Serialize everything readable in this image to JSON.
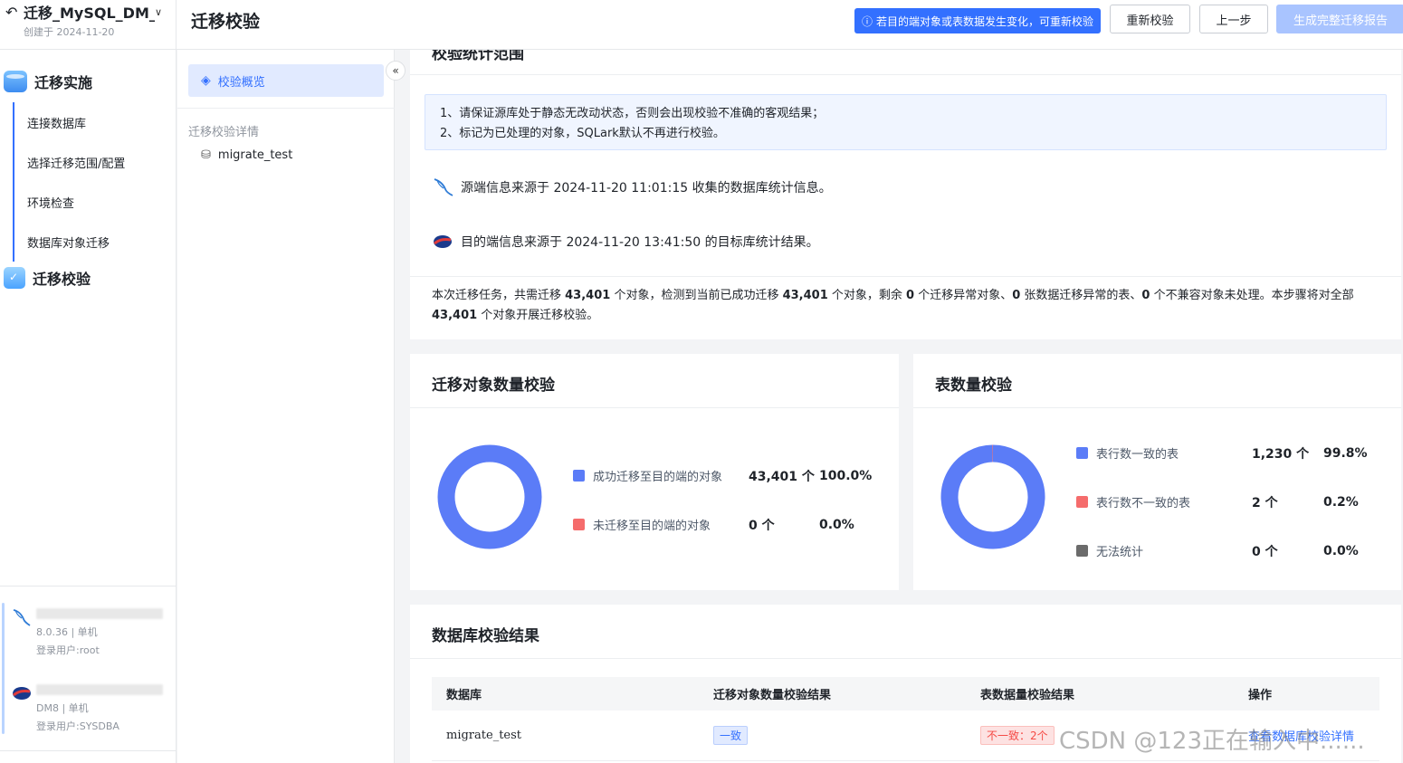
{
  "project": {
    "title": "迁移_MySQL_DM_...",
    "created": "创建于 2024-11-20"
  },
  "steps": {
    "implement": "迁移实施",
    "verify": "迁移校验",
    "sub": [
      "连接数据库",
      "选择迁移范围/配置",
      "环境检查",
      "数据库对象迁移"
    ]
  },
  "connections": {
    "source": {
      "version": "8.0.36 | 单机",
      "user": "登录用户:root"
    },
    "target": {
      "version": "DM8 | 单机",
      "user": "登录用户:SYSDBA"
    }
  },
  "header": {
    "title": "迁移校验",
    "notice": "若目的端对象或表数据发生变化，可重新校验",
    "recheck": "重新校验",
    "prev": "上一步",
    "report": "生成完整迁移报告"
  },
  "nav": {
    "overview": "校验概览",
    "details_section": "迁移校验详情",
    "db": "migrate_test"
  },
  "scope": {
    "title": "校验统计范围",
    "tips": [
      "1、请保证源库处于静态无改动状态，否则会出现校验不准确的客观结果；",
      "2、标记为已处理的对象，SQLark默认不再进行校验。"
    ],
    "source_info": "源端信息来源于 2024-11-20 11:01:15 收集的数据库统计信息。",
    "target_info": "目的端信息来源于 2024-11-20 13:41:50 的目标库统计结果。",
    "summary": {
      "p1": "本次迁移任务，共需迁移 ",
      "n1": "43,401",
      "p2": " 个对象，检测到当前已成功迁移 ",
      "n2": "43,401",
      "p3": " 个对象，剩余 ",
      "n3": "0",
      "p4": " 个迁移异常对象、",
      "n4": "0",
      "p5": " 张数据迁移异常的表、",
      "n5": "0",
      "p6": " 个不兼容对象未处理。本步骤将对全部 ",
      "n6": "43,401",
      "p7": " 个对象开展迁移校验。"
    }
  },
  "object_check": {
    "title": "迁移对象数量校验",
    "items": [
      {
        "label": "成功迁移至目的端的对象",
        "count": "43,401 个",
        "pct": "100.0%",
        "color": "#5b7cf7",
        "value": 43401
      },
      {
        "label": "未迁移至目的端的对象",
        "count": "0 个",
        "pct": "0.0%",
        "color": "#f56c6c",
        "value": 0
      }
    ]
  },
  "table_check": {
    "title": "表数量校验",
    "items": [
      {
        "label": "表行数一致的表",
        "count": "1,230 个",
        "pct": "99.8%",
        "color": "#5b7cf7",
        "value": 1230
      },
      {
        "label": "表行数不一致的表",
        "count": "2 个",
        "pct": "0.2%",
        "color": "#f56c6c",
        "value": 2
      },
      {
        "label": "无法统计",
        "count": "0 个",
        "pct": "0.0%",
        "color": "#6b6b6b",
        "value": 0
      }
    ]
  },
  "result": {
    "title": "数据库校验结果",
    "headers": [
      "数据库",
      "迁移对象数量校验结果",
      "表数据量校验结果",
      "操作"
    ],
    "rows": [
      {
        "db": "migrate_test",
        "obj": "一致",
        "tbl": "不一致：2个",
        "action": "查看数据库校验详情"
      }
    ]
  },
  "watermark": "CSDN @123正在输入中......"
}
